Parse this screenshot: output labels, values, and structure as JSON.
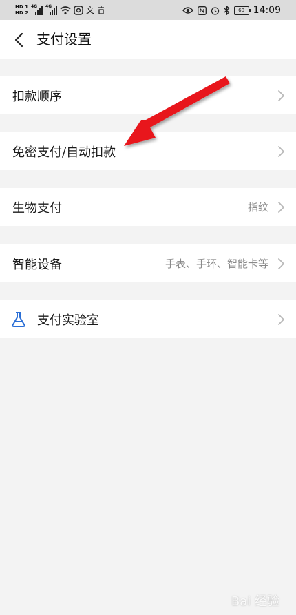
{
  "status_bar": {
    "hd1": "HD 1",
    "hd2": "HD 2",
    "net_type_1": "4G",
    "net_type_2": "4G",
    "battery": "60",
    "time": "14:09"
  },
  "header": {
    "title": "支付设置"
  },
  "settings": [
    {
      "label": "扣款顺序",
      "value": ""
    },
    {
      "label": "免密支付/自动扣款",
      "value": ""
    },
    {
      "label": "生物支付",
      "value": "指纹"
    },
    {
      "label": "智能设备",
      "value": "手表、手环、智能卡等"
    },
    {
      "label": "支付实验室",
      "value": ""
    }
  ],
  "colors": {
    "arrow": "#e8141a",
    "flask_icon": "#2b6fd6",
    "chevron": "#b8b8b8"
  },
  "watermark": "Bai 经验"
}
